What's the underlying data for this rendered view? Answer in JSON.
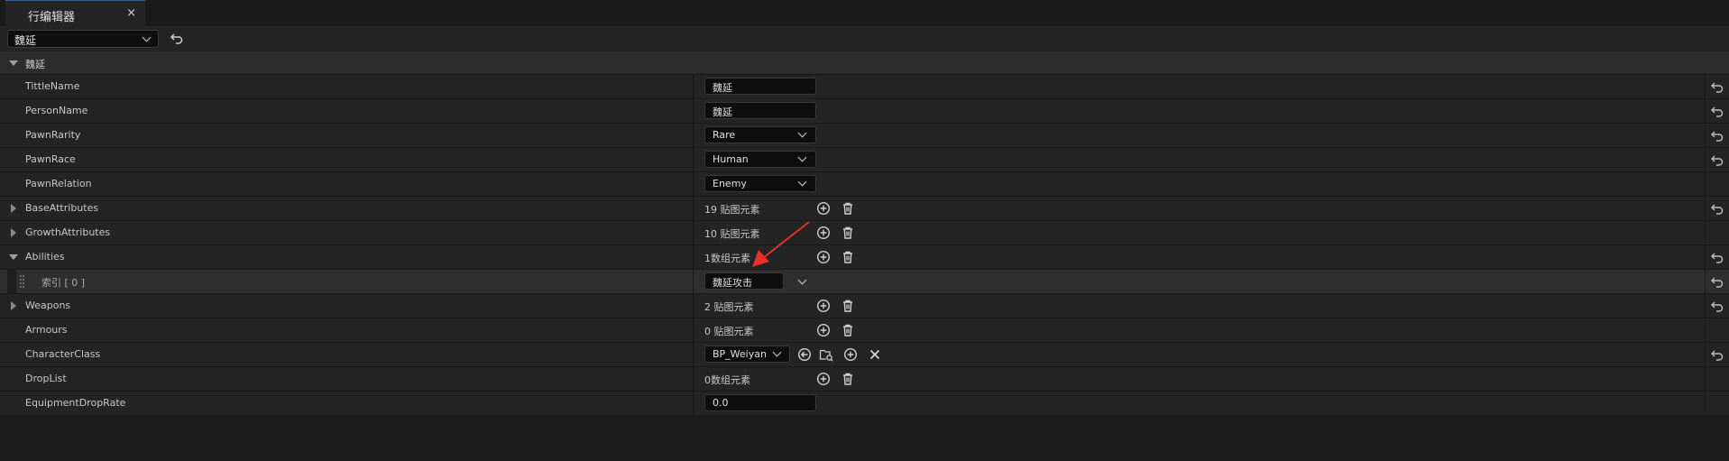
{
  "window": {
    "tab_title": "行编辑器",
    "close_glyph": "×"
  },
  "toolbar": {
    "row_selector": "魏延"
  },
  "category": {
    "label": "魏延"
  },
  "rows": {
    "tittle_name": {
      "label": "TittleName",
      "value": "魏延"
    },
    "person_name": {
      "label": "PersonName",
      "value": "魏延"
    },
    "pawn_rarity": {
      "label": "PawnRarity",
      "value": "Rare"
    },
    "pawn_race": {
      "label": "PawnRace",
      "value": "Human"
    },
    "pawn_relation": {
      "label": "PawnRelation",
      "value": "Enemy"
    },
    "base_attributes": {
      "label": "BaseAttributes",
      "value": "19 贴图元素"
    },
    "growth_attributes": {
      "label": "GrowthAttributes",
      "value": "10 贴图元素"
    },
    "abilities": {
      "label": "Abilities",
      "value": "1数组元素"
    },
    "abilities_index0": {
      "label": "索引 [ 0 ]",
      "value": "魏延攻击"
    },
    "weapons": {
      "label": "Weapons",
      "value": "2 贴图元素"
    },
    "armours": {
      "label": "Armours",
      "value": "0 贴图元素"
    },
    "character_class": {
      "label": "CharacterClass",
      "value": "BP_Weiyan"
    },
    "drop_list": {
      "label": "DropList",
      "value": "0数组元素"
    },
    "equipment_drop_rate": {
      "label": "EquipmentDropRate",
      "value": "0.0"
    }
  },
  "colors": {
    "annotation_arrow": "#e8302a",
    "tab_accent": "#3a5f8f"
  }
}
